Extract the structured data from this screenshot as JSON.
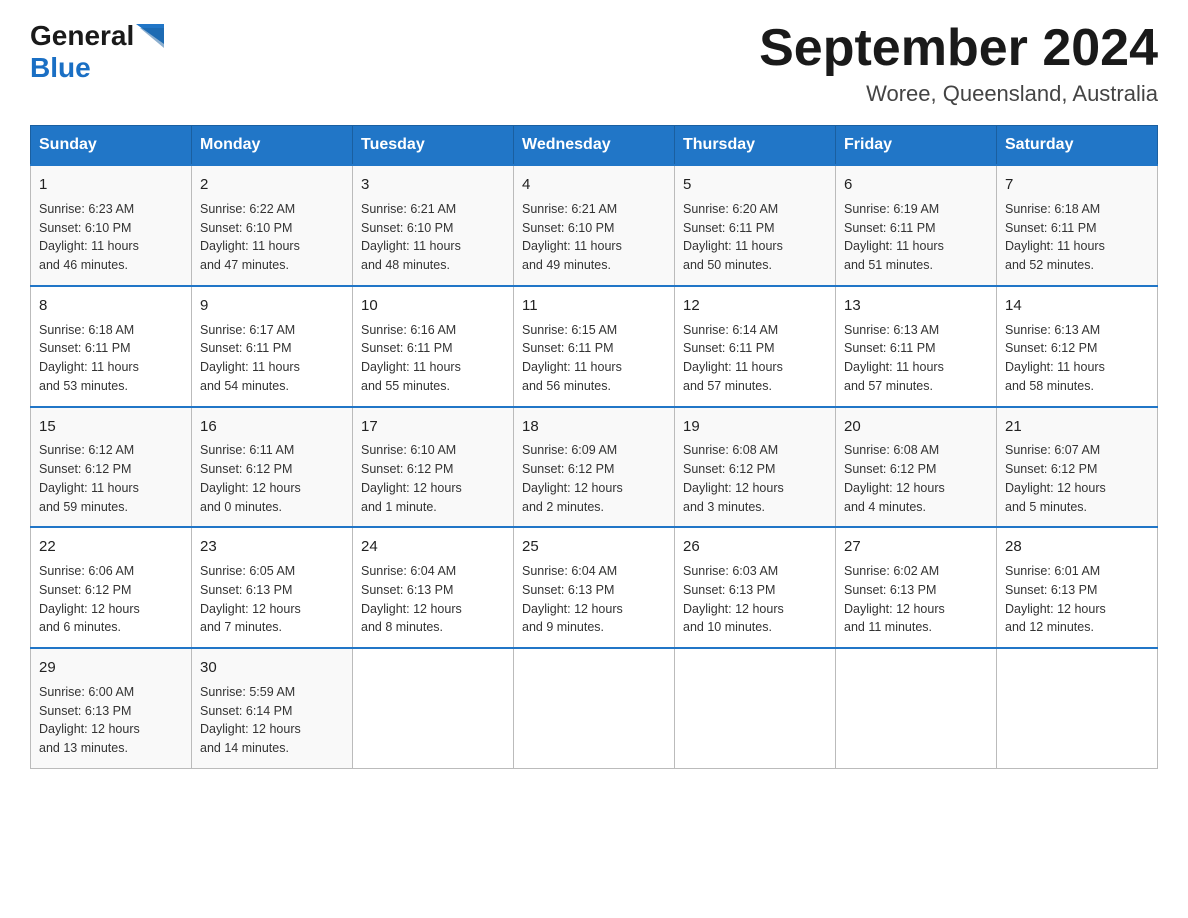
{
  "header": {
    "logo_general": "General",
    "logo_blue": "Blue",
    "title": "September 2024",
    "subtitle": "Woree, Queensland, Australia"
  },
  "days_of_week": [
    "Sunday",
    "Monday",
    "Tuesday",
    "Wednesday",
    "Thursday",
    "Friday",
    "Saturday"
  ],
  "weeks": [
    [
      {
        "day": "1",
        "sunrise": "6:23 AM",
        "sunset": "6:10 PM",
        "daylight": "11 hours and 46 minutes."
      },
      {
        "day": "2",
        "sunrise": "6:22 AM",
        "sunset": "6:10 PM",
        "daylight": "11 hours and 47 minutes."
      },
      {
        "day": "3",
        "sunrise": "6:21 AM",
        "sunset": "6:10 PM",
        "daylight": "11 hours and 48 minutes."
      },
      {
        "day": "4",
        "sunrise": "6:21 AM",
        "sunset": "6:10 PM",
        "daylight": "11 hours and 49 minutes."
      },
      {
        "day": "5",
        "sunrise": "6:20 AM",
        "sunset": "6:11 PM",
        "daylight": "11 hours and 50 minutes."
      },
      {
        "day": "6",
        "sunrise": "6:19 AM",
        "sunset": "6:11 PM",
        "daylight": "11 hours and 51 minutes."
      },
      {
        "day": "7",
        "sunrise": "6:18 AM",
        "sunset": "6:11 PM",
        "daylight": "11 hours and 52 minutes."
      }
    ],
    [
      {
        "day": "8",
        "sunrise": "6:18 AM",
        "sunset": "6:11 PM",
        "daylight": "11 hours and 53 minutes."
      },
      {
        "day": "9",
        "sunrise": "6:17 AM",
        "sunset": "6:11 PM",
        "daylight": "11 hours and 54 minutes."
      },
      {
        "day": "10",
        "sunrise": "6:16 AM",
        "sunset": "6:11 PM",
        "daylight": "11 hours and 55 minutes."
      },
      {
        "day": "11",
        "sunrise": "6:15 AM",
        "sunset": "6:11 PM",
        "daylight": "11 hours and 56 minutes."
      },
      {
        "day": "12",
        "sunrise": "6:14 AM",
        "sunset": "6:11 PM",
        "daylight": "11 hours and 57 minutes."
      },
      {
        "day": "13",
        "sunrise": "6:13 AM",
        "sunset": "6:11 PM",
        "daylight": "11 hours and 57 minutes."
      },
      {
        "day": "14",
        "sunrise": "6:13 AM",
        "sunset": "6:12 PM",
        "daylight": "11 hours and 58 minutes."
      }
    ],
    [
      {
        "day": "15",
        "sunrise": "6:12 AM",
        "sunset": "6:12 PM",
        "daylight": "11 hours and 59 minutes."
      },
      {
        "day": "16",
        "sunrise": "6:11 AM",
        "sunset": "6:12 PM",
        "daylight": "12 hours and 0 minutes."
      },
      {
        "day": "17",
        "sunrise": "6:10 AM",
        "sunset": "6:12 PM",
        "daylight": "12 hours and 1 minute."
      },
      {
        "day": "18",
        "sunrise": "6:09 AM",
        "sunset": "6:12 PM",
        "daylight": "12 hours and 2 minutes."
      },
      {
        "day": "19",
        "sunrise": "6:08 AM",
        "sunset": "6:12 PM",
        "daylight": "12 hours and 3 minutes."
      },
      {
        "day": "20",
        "sunrise": "6:08 AM",
        "sunset": "6:12 PM",
        "daylight": "12 hours and 4 minutes."
      },
      {
        "day": "21",
        "sunrise": "6:07 AM",
        "sunset": "6:12 PM",
        "daylight": "12 hours and 5 minutes."
      }
    ],
    [
      {
        "day": "22",
        "sunrise": "6:06 AM",
        "sunset": "6:12 PM",
        "daylight": "12 hours and 6 minutes."
      },
      {
        "day": "23",
        "sunrise": "6:05 AM",
        "sunset": "6:13 PM",
        "daylight": "12 hours and 7 minutes."
      },
      {
        "day": "24",
        "sunrise": "6:04 AM",
        "sunset": "6:13 PM",
        "daylight": "12 hours and 8 minutes."
      },
      {
        "day": "25",
        "sunrise": "6:04 AM",
        "sunset": "6:13 PM",
        "daylight": "12 hours and 9 minutes."
      },
      {
        "day": "26",
        "sunrise": "6:03 AM",
        "sunset": "6:13 PM",
        "daylight": "12 hours and 10 minutes."
      },
      {
        "day": "27",
        "sunrise": "6:02 AM",
        "sunset": "6:13 PM",
        "daylight": "12 hours and 11 minutes."
      },
      {
        "day": "28",
        "sunrise": "6:01 AM",
        "sunset": "6:13 PM",
        "daylight": "12 hours and 12 minutes."
      }
    ],
    [
      {
        "day": "29",
        "sunrise": "6:00 AM",
        "sunset": "6:13 PM",
        "daylight": "12 hours and 13 minutes."
      },
      {
        "day": "30",
        "sunrise": "5:59 AM",
        "sunset": "6:14 PM",
        "daylight": "12 hours and 14 minutes."
      },
      null,
      null,
      null,
      null,
      null
    ]
  ],
  "labels": {
    "sunrise": "Sunrise:",
    "sunset": "Sunset:",
    "daylight": "Daylight:"
  }
}
